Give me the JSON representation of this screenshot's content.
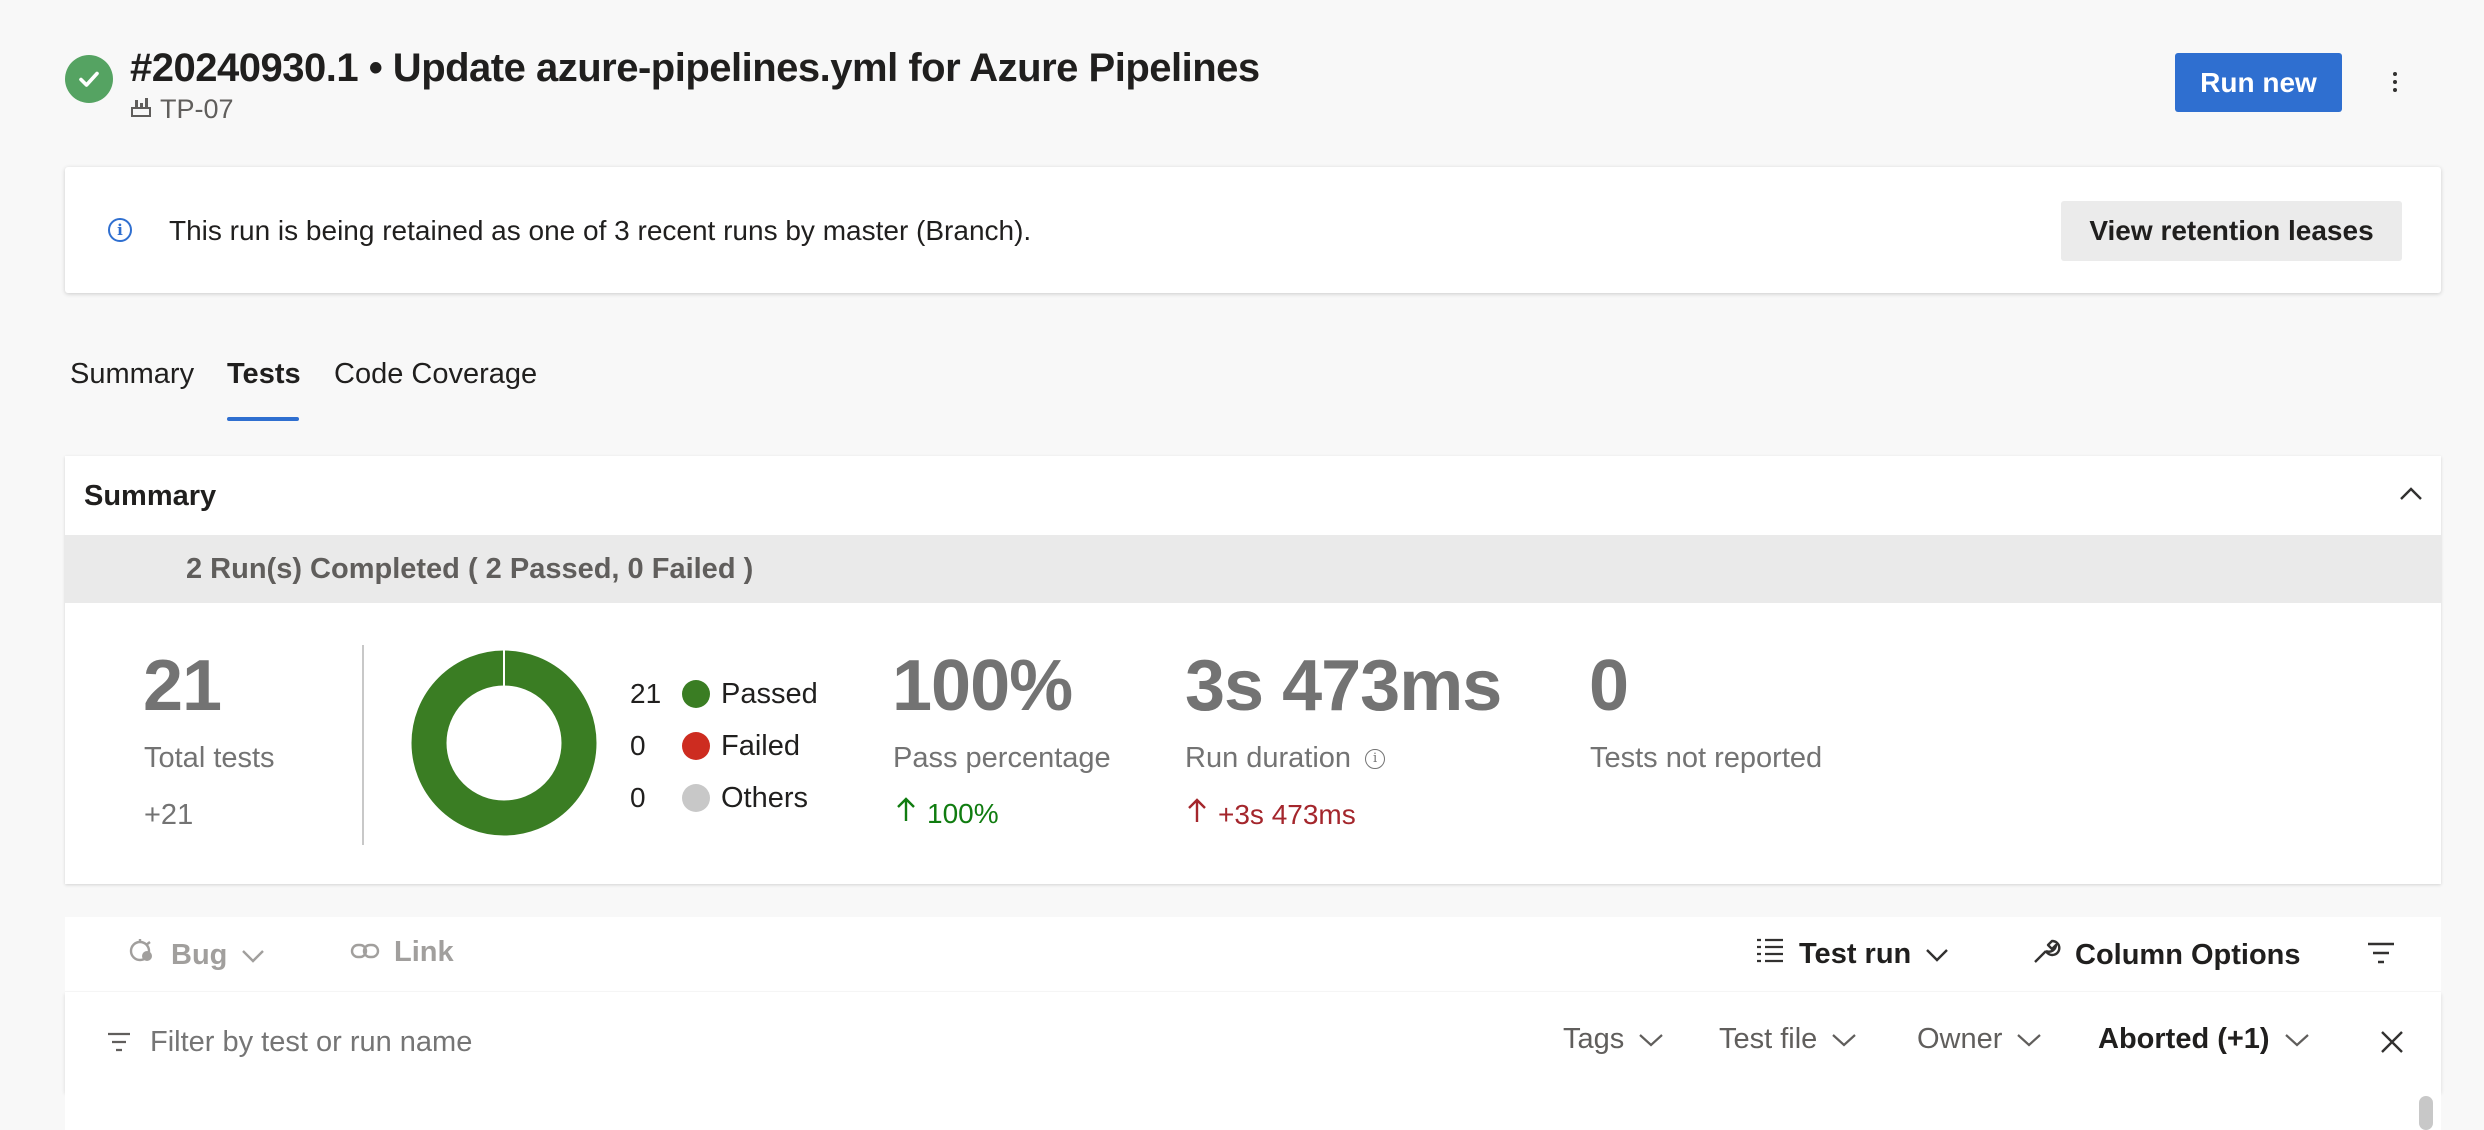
{
  "header": {
    "title": "#20240930.1 • Update azure-pipelines.yml for Azure Pipelines",
    "subtitle": "TP-07",
    "run_new_label": "Run new"
  },
  "banner": {
    "text": "This run is being retained as one of 3 recent runs by master (Branch).",
    "button_label": "View retention leases"
  },
  "tabs": [
    {
      "label": "Summary",
      "active": false
    },
    {
      "label": "Tests",
      "active": true
    },
    {
      "label": "Code Coverage",
      "active": false
    }
  ],
  "summary": {
    "title": "Summary",
    "runs_completed": "2 Run(s) Completed ( 2 Passed, 0 Failed )",
    "total_tests": {
      "value": "21",
      "label": "Total tests",
      "delta": "+21"
    },
    "legend": [
      {
        "count": "21",
        "label": "Passed",
        "color": "#3a7d23"
      },
      {
        "count": "0",
        "label": "Failed",
        "color": "#cd2c20"
      },
      {
        "count": "0",
        "label": "Others",
        "color": "#c8c8c8"
      }
    ],
    "pass_percentage": {
      "value": "100%",
      "label": "Pass percentage",
      "trend": "100%"
    },
    "run_duration": {
      "value": "3s 473ms",
      "label": "Run duration",
      "trend": "+3s 473ms"
    },
    "not_reported": {
      "value": "0",
      "label": "Tests not reported"
    }
  },
  "chart_data": {
    "type": "pie",
    "categories": [
      "Passed",
      "Failed",
      "Others"
    ],
    "values": [
      21,
      0,
      0
    ],
    "colors": [
      "#3a7d23",
      "#cd2c20",
      "#c8c8c8"
    ]
  },
  "toolbar": {
    "bug_label": "Bug",
    "link_label": "Link",
    "test_run_label": "Test run",
    "column_options_label": "Column Options"
  },
  "filters": {
    "placeholder": "Filter by test or run name",
    "tags_label": "Tags",
    "test_file_label": "Test file",
    "owner_label": "Owner",
    "outcome_label": "Aborted (+1)"
  },
  "colors": {
    "accent": "#2f6fd0",
    "success": "#55a362",
    "trend_up_green": "#107c10",
    "trend_up_red": "#a4262c"
  }
}
